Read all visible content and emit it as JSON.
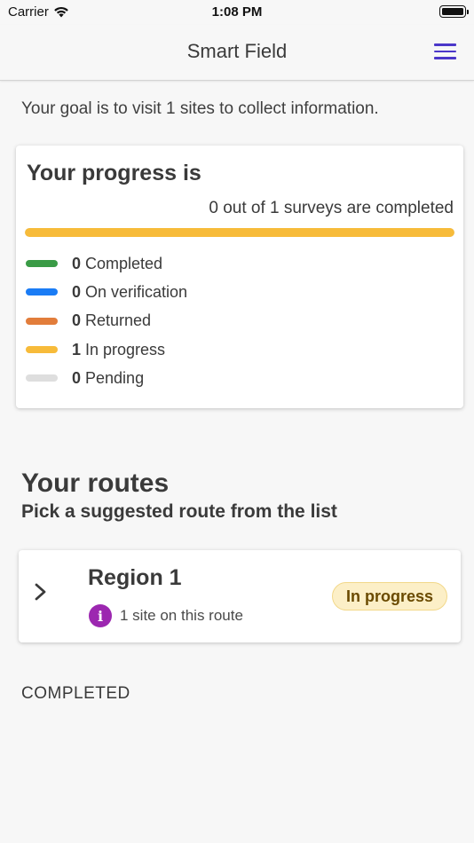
{
  "status_bar": {
    "carrier": "Carrier",
    "time": "1:08 PM"
  },
  "nav": {
    "title": "Smart Field"
  },
  "goal_text": "Your goal is to visit 1 sites to collect information.",
  "progress": {
    "title": "Your progress is",
    "summary": "0 out of 1 surveys are completed",
    "bar_fill_fraction": 1.0,
    "bar_fill_color": "#f7bb3a",
    "legend": [
      {
        "count": "0",
        "label": "Completed",
        "color": "#3a9b46"
      },
      {
        "count": "0",
        "label": "On verification",
        "color": "#1a7cf5"
      },
      {
        "count": "0",
        "label": "Returned",
        "color": "#e27d3b"
      },
      {
        "count": "1",
        "label": "In progress",
        "color": "#f7bb3a"
      },
      {
        "count": "0",
        "label": "Pending",
        "color": "#dedede"
      }
    ]
  },
  "routes": {
    "title": "Your routes",
    "subtitle": "Pick a suggested route from the list",
    "items": [
      {
        "name": "Region 1",
        "info": "1 site on this route",
        "status": "In progress"
      }
    ]
  },
  "completed_heading": "COMPLETED",
  "colors": {
    "accent": "#4b37c9",
    "info_icon": "#9c27b0",
    "badge_bg": "#fcefc7"
  }
}
